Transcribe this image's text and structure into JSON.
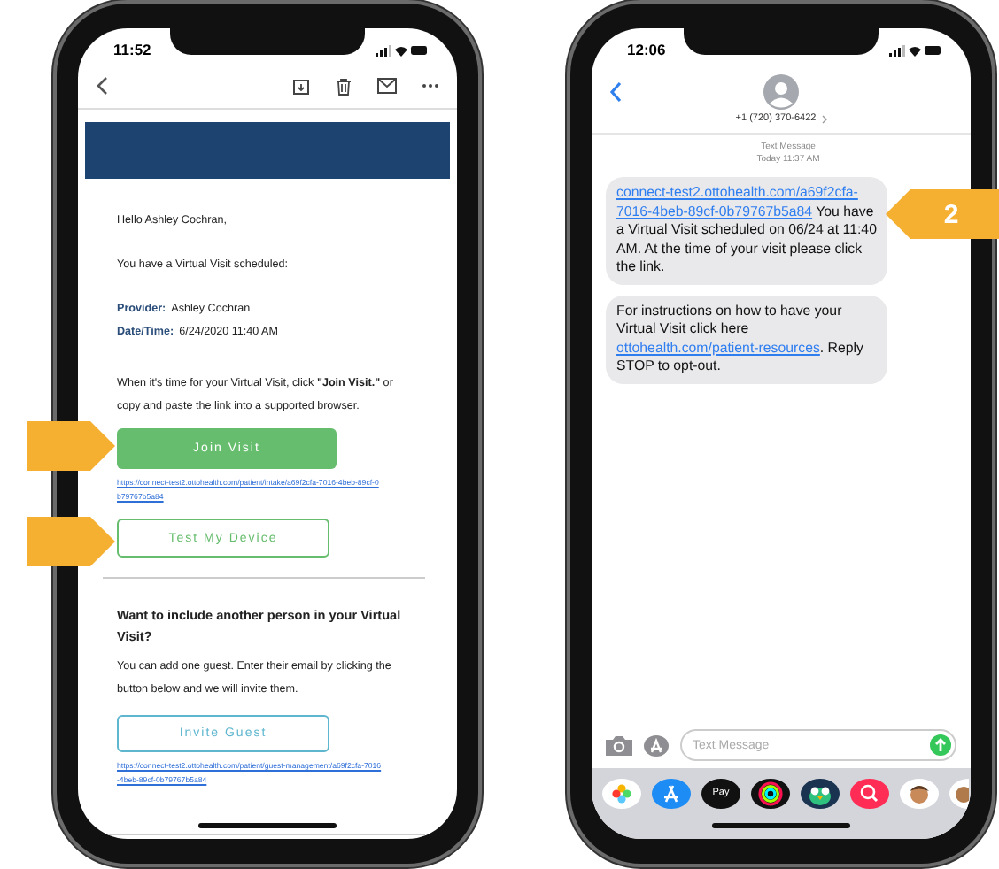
{
  "email_phone": {
    "status_time": "11:52",
    "greeting": "Hello Ashley Cochran,",
    "intro": "You have a Virtual Visit scheduled:",
    "details": [
      {
        "label": "Provider:",
        "value": "Ashley Cochran"
      },
      {
        "label": "Date/Time:",
        "value": "6/24/2020 11:40 AM"
      }
    ],
    "instructions": "When it's time for your Virtual Visit, click **\"Join Visit.\"** or copy and paste the link into a supported browser.",
    "join_button": "Join Visit",
    "join_link": "https://connect-test2.ottohealth.com/patient/intake/a69f2cfa-7016-4beb-89cf-0b79767b5a84",
    "test_button": "Test My Device",
    "guest_heading": "Want to include another person in your Virtual Visit?",
    "guest_text": "You can add one guest. Enter their email by clicking the button below and we will invite them.",
    "guest_button": "Invite Guest",
    "guest_link": "https://connect-test2.ottohealth.com/patient/guest-management/a69f2cfa-7016-4beb-89cf-0b79767b5a84"
  },
  "messages_phone": {
    "status_time": "12:06",
    "contact": "+1 (720) 370-6422",
    "service": "Text Message",
    "timestamp": "Today 11:37 AM",
    "messages": [
      {
        "parts": [
          {
            "kind": "link",
            "text": "connect-test2.ottohealth.com/a69f2cfa-7016-4beb-89cf-0b79767b5a84"
          },
          {
            "kind": "text",
            "text": " You have a Virtual Visit scheduled on 06/24 at 11:40 AM. At the time of your visit please click the link."
          }
        ]
      },
      {
        "parts": [
          {
            "kind": "text",
            "text": "For instructions on how to have your Virtual Visit click here "
          },
          {
            "kind": "link",
            "text": "ottohealth.com/patient-resources"
          },
          {
            "kind": "text",
            "text": ". Reply STOP to opt-out."
          }
        ]
      }
    ],
    "input": {
      "placeholder": "Text Message"
    },
    "apps": [
      {
        "kind": "photos"
      },
      {
        "kind": "appstore"
      },
      {
        "kind": "pay",
        "label": "Pay"
      },
      {
        "kind": "activity"
      },
      {
        "kind": "game"
      },
      {
        "kind": "images"
      },
      {
        "kind": "memoji"
      },
      {
        "kind": "animoji"
      }
    ]
  },
  "callouts": [
    {
      "kind": "arrow"
    },
    {
      "kind": "arrow"
    },
    {
      "kind": "badge",
      "label": "2"
    }
  ]
}
